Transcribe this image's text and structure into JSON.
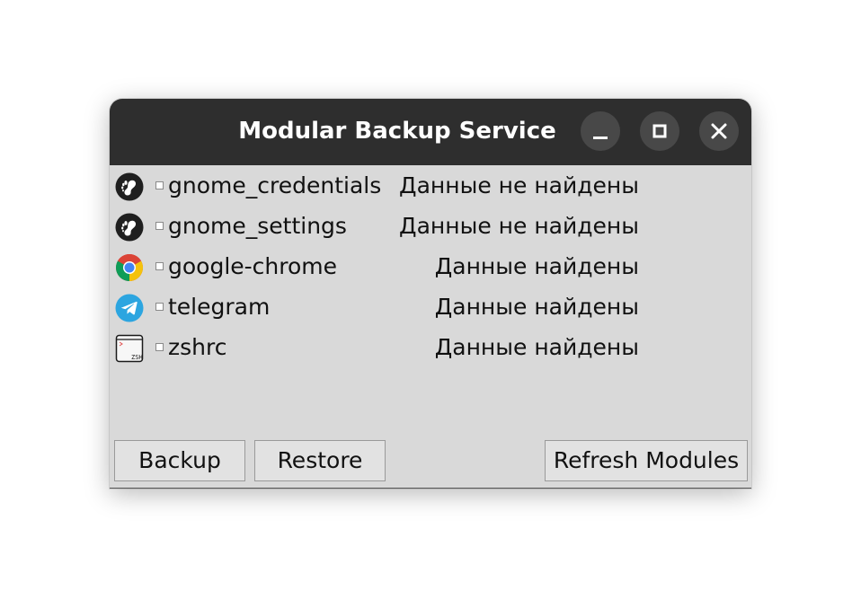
{
  "window": {
    "title": "Modular Backup Service",
    "controls": {
      "minimize": "minimize-icon",
      "maximize": "maximize-icon",
      "close": "close-icon"
    }
  },
  "modules": [
    {
      "name": "gnome_credentials",
      "status": "Данные не найдены",
      "icon": "gnome-icon",
      "checked": false
    },
    {
      "name": "gnome_settings",
      "status": "Данные не найдены",
      "icon": "gnome-icon",
      "checked": false
    },
    {
      "name": "google-chrome",
      "status": "Данные найдены",
      "icon": "chrome-icon",
      "checked": false
    },
    {
      "name": "telegram",
      "status": "Данные найдены",
      "icon": "telegram-icon",
      "checked": false
    },
    {
      "name": "zshrc",
      "status": "Данные найдены",
      "icon": "terminal-zsh-icon",
      "checked": false
    }
  ],
  "buttons": {
    "backup": "Backup",
    "restore": "Restore",
    "refresh": "Refresh Modules"
  },
  "colors": {
    "titlebar": "#2e2e2e",
    "window_bg": "#d9d9d9",
    "telegram_blue": "#2ca5e0"
  }
}
